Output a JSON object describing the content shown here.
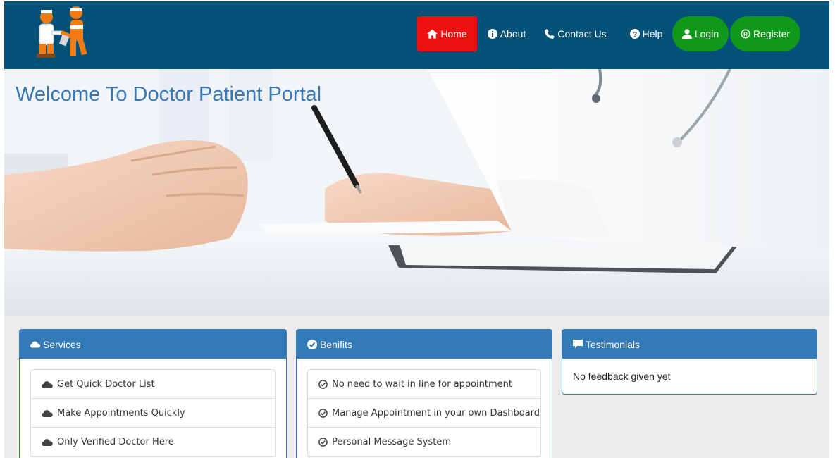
{
  "navbar": {
    "items": [
      {
        "label": "Home",
        "icon": "home-icon",
        "active": true,
        "color": "#ee0f0f"
      },
      {
        "label": "About",
        "icon": "info-icon"
      },
      {
        "label": "Contact Us",
        "icon": "phone-icon"
      },
      {
        "label": "Help",
        "icon": "question-icon"
      },
      {
        "label": "Login",
        "icon": "user-icon",
        "color": "#10981b"
      },
      {
        "label": "Register",
        "icon": "registered-icon",
        "color": "#10981b"
      }
    ],
    "background": "#035177"
  },
  "hero": {
    "title": "Welcome To Doctor Patient Portal"
  },
  "panels": {
    "services": {
      "heading": "Services",
      "icon": "cloud-icon",
      "items": [
        "Get Quick Doctor List",
        "Make Appointments Quickly",
        "Only Verified Doctor Here"
      ]
    },
    "benefits": {
      "heading": "Benifits",
      "icon": "check-circle-icon",
      "items": [
        "No need to wait in line for appointment",
        "Manage Appointment in your own Dashboard",
        "Personal Message System"
      ]
    },
    "testimonials": {
      "heading": "Testimonials",
      "icon": "comment-icon",
      "text": "No feedback given yet"
    }
  },
  "colors": {
    "panel_heading": "#337ab7",
    "title": "#3a79b3"
  }
}
